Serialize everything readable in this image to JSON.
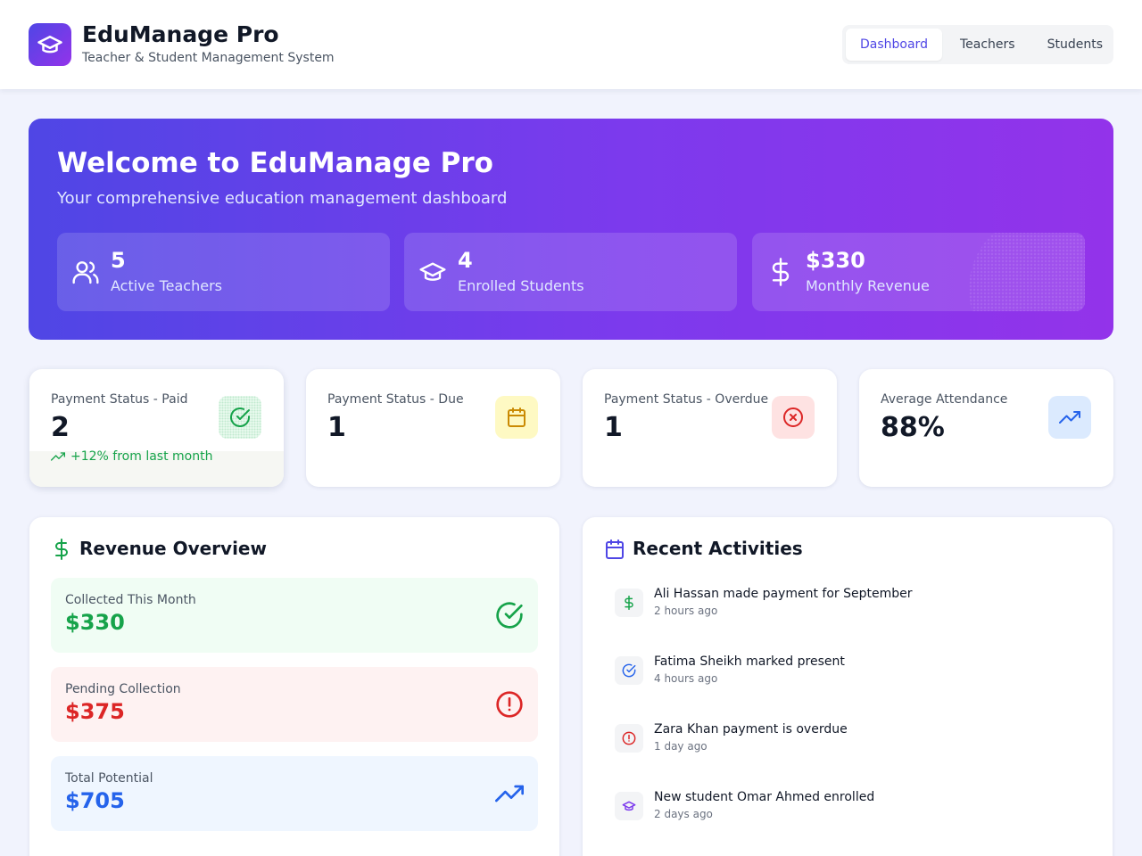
{
  "app": {
    "title": "EduManage Pro",
    "subtitle": "Teacher & Student Management System",
    "logo_icon": "graduation-cap-icon"
  },
  "nav": {
    "tabs": [
      {
        "label": "Dashboard",
        "active": true
      },
      {
        "label": "Teachers",
        "active": false
      },
      {
        "label": "Students",
        "active": false
      }
    ]
  },
  "hero": {
    "title": "Welcome to EduManage Pro",
    "subtitle": "Your comprehensive education management dashboard",
    "stats": [
      {
        "icon": "users-icon",
        "value": "5",
        "label": "Active Teachers"
      },
      {
        "icon": "graduation-cap-icon",
        "value": "4",
        "label": "Enrolled Students"
      },
      {
        "icon": "dollar-icon",
        "value": "$330",
        "label": "Monthly Revenue"
      }
    ]
  },
  "payment_cards": [
    {
      "label": "Payment Status - Paid",
      "value": "2",
      "trend": "+12% from last month",
      "icon": "check-circle-icon",
      "color": "#16a34a"
    },
    {
      "label": "Payment Status - Due",
      "value": "1",
      "icon": "calendar-icon",
      "color": "#ca8a04"
    },
    {
      "label": "Payment Status - Overdue",
      "value": "1",
      "icon": "x-circle-icon",
      "color": "#dc2626"
    },
    {
      "label": "Average Attendance",
      "value": "88%",
      "icon": "trending-up-icon",
      "color": "#2563eb"
    }
  ],
  "revenue": {
    "title": "Revenue Overview",
    "items": [
      {
        "label": "Collected This Month",
        "value": "$330",
        "color": "#16a34a",
        "icon": "check-circle-icon"
      },
      {
        "label": "Pending Collection",
        "value": "$375",
        "color": "#dc2626",
        "icon": "alert-circle-icon"
      },
      {
        "label": "Total Potential",
        "value": "$705",
        "color": "#2563eb",
        "icon": "trending-up-icon"
      }
    ]
  },
  "activities": {
    "title": "Recent Activities",
    "items": [
      {
        "text": "Ali Hassan made payment for September",
        "time": "2 hours ago",
        "icon": "dollar-icon"
      },
      {
        "text": "Fatima Sheikh marked present",
        "time": "4 hours ago",
        "icon": "check-circle-icon"
      },
      {
        "text": "Zara Khan payment is overdue",
        "time": "1 day ago",
        "icon": "alert-circle-icon"
      },
      {
        "text": "New student Omar Ahmed enrolled",
        "time": "2 days ago",
        "icon": "graduation-cap-icon"
      }
    ]
  }
}
